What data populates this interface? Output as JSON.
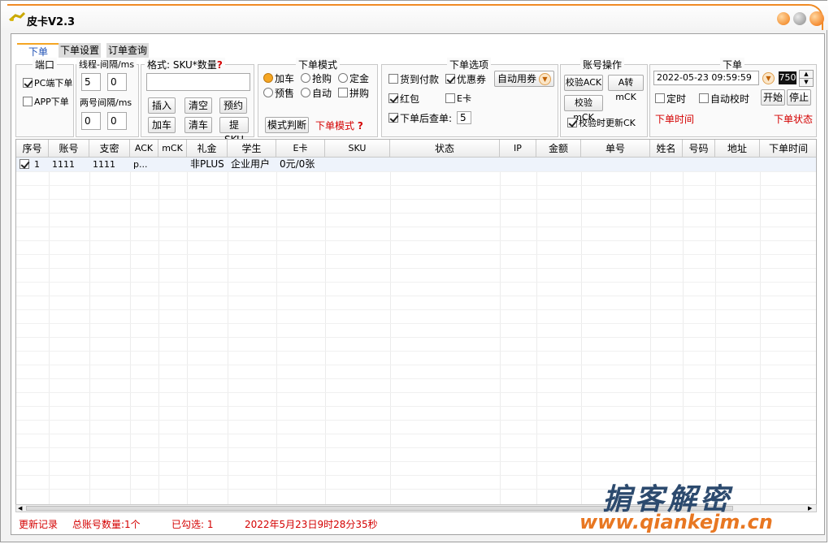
{
  "window": {
    "title": "皮卡V2.3"
  },
  "tabs": [
    {
      "label": "下单",
      "active": true
    },
    {
      "label": "下单设置",
      "active": false
    },
    {
      "label": "订单查询",
      "active": false
    }
  ],
  "port": {
    "title": "端口",
    "pc_label": "PC端下单",
    "pc_checked": true,
    "app_label": "APP下单",
    "app_checked": false
  },
  "thread": {
    "title": "线程-间隔/ms",
    "v1": "5",
    "v2": "0",
    "two_interval_label": "两号间隔/ms",
    "v3": "0",
    "v4": "0"
  },
  "format": {
    "title": "格式: SKU*数量",
    "q": "?",
    "input_value": "",
    "buttons": [
      "插入",
      "清空",
      "预约",
      "加车",
      "清车",
      "提SKU"
    ]
  },
  "mode": {
    "title": "下单模式",
    "radios": [
      {
        "label": "加车",
        "on": true
      },
      {
        "label": "抢购",
        "on": false
      },
      {
        "label": "定金",
        "on": false
      },
      {
        "label": "预售",
        "on": false
      },
      {
        "label": "自动",
        "on": false
      }
    ],
    "pin_label": "拼购",
    "judge_button": "模式判断",
    "mode_label": "下单模式",
    "q": "?"
  },
  "options": {
    "title": "下单选项",
    "cod_label": "货到付款",
    "cod_checked": false,
    "coupon_label": "优惠券",
    "coupon_checked": true,
    "auto_coupon_button": "自动用券",
    "redpack_label": "红包",
    "redpack_checked": true,
    "ecard_label": "E卡",
    "ecard_checked": false,
    "check_after_label": "下单后查单:",
    "check_after_checked": true,
    "check_after_value": "5"
  },
  "account": {
    "title": "账号操作",
    "verify_ack": "校验ACK",
    "a_to_mck": "A转mCK",
    "verify_mck": "校验mCK",
    "update_ck_label": "校验时更新CK",
    "update_ck_checked": true
  },
  "order": {
    "title": "下单",
    "datetime": "2022-05-23 09:59:59",
    "ms_value": "750",
    "timer_label": "定时",
    "timer_checked": false,
    "auto_sync_label": "自动校时",
    "auto_sync_checked": false,
    "start_button": "开始",
    "stop_button": "停止",
    "time_label": "下单时间",
    "status_label": "下单状态"
  },
  "table": {
    "headers": [
      "序号",
      "账号",
      "支密",
      "ACK",
      "mCK",
      "礼金",
      "学生",
      "E卡",
      "SKU",
      "状态",
      "IP",
      "金额",
      "单号",
      "姓名",
      "号码",
      "地址",
      "下单时间"
    ],
    "rows": [
      {
        "checked": true,
        "cells": [
          "1",
          "1111",
          "1111",
          "p...",
          "",
          "非PLUS",
          "企业用户",
          "0元/0张",
          "",
          "",
          "",
          "",
          "",
          "",
          "",
          "",
          ""
        ]
      }
    ]
  },
  "status_bar": {
    "update_log": "更新记录",
    "total_accounts": "总账号数量:1个",
    "selected": "已勾选: 1",
    "timestamp": "2022年5月23日9时28分35秒"
  },
  "watermark": {
    "cn": "掮客解密",
    "url": "www.qiankejm.cn"
  },
  "colors": {
    "accent": "#f5a623",
    "red_text": "#d40000",
    "title_arc": "#f08a24"
  }
}
